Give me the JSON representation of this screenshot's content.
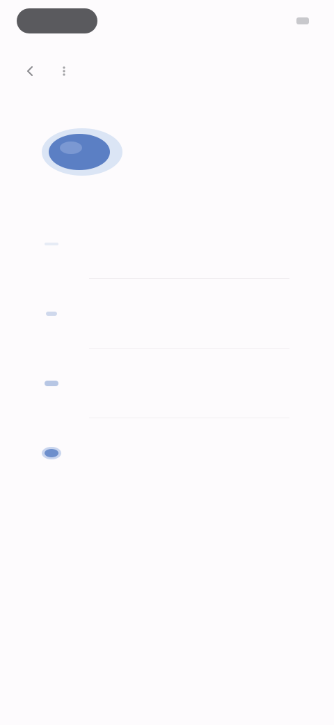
{
  "status_bar": {
    "left_pill_text": "",
    "right_text": ""
  },
  "nav": {
    "back_icon": "back-arrow-icon",
    "more_icon": "more-icon"
  },
  "hero": {
    "title": "",
    "subtitle": "",
    "art_color": "#5b7fc4"
  },
  "options": [
    {
      "icon": "icon-1",
      "label": ""
    },
    {
      "icon": "icon-2",
      "label": ""
    },
    {
      "icon": "icon-3",
      "label": ""
    },
    {
      "icon": "icon-4",
      "label": ""
    }
  ],
  "colors": {
    "background": "#fdfbfd",
    "accent": "#5b7fc4"
  }
}
